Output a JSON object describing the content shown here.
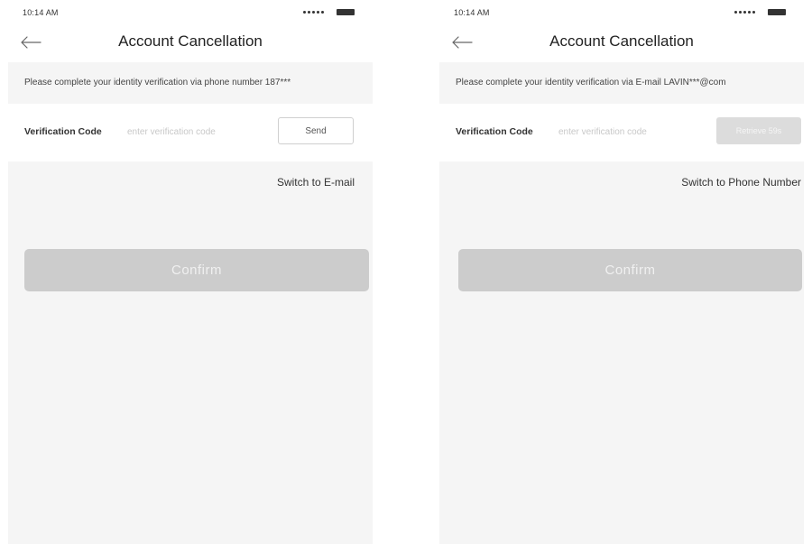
{
  "screens": [
    {
      "status_time": "10:14 AM",
      "title": "Account Cancellation",
      "notice": "Please complete your identity verification via phone number 187***",
      "code_label": "Verification Code",
      "code_placeholder": "enter verification code",
      "code_value": "",
      "send_label": "Send",
      "switch_label": "Switch to E-mail",
      "confirm_label": "Confirm"
    },
    {
      "status_time": "10:14 AM",
      "title": "Account Cancellation",
      "notice": "Please complete your identity verification via E-mail LAVIN***@com",
      "code_label": "Verification Code",
      "code_placeholder": "enter verification code",
      "code_value": "",
      "retrieve_label": "Retrieve 59s",
      "switch_label": "Switch to Phone Number",
      "confirm_label": "Confirm"
    }
  ],
  "icons": {
    "back": "arrow-left-icon",
    "signal": "signal-dots-icon",
    "battery": "battery-icon"
  },
  "colors": {
    "background": "#f5f5f5",
    "button_disabled": "#cccccc",
    "text": "#333333"
  }
}
